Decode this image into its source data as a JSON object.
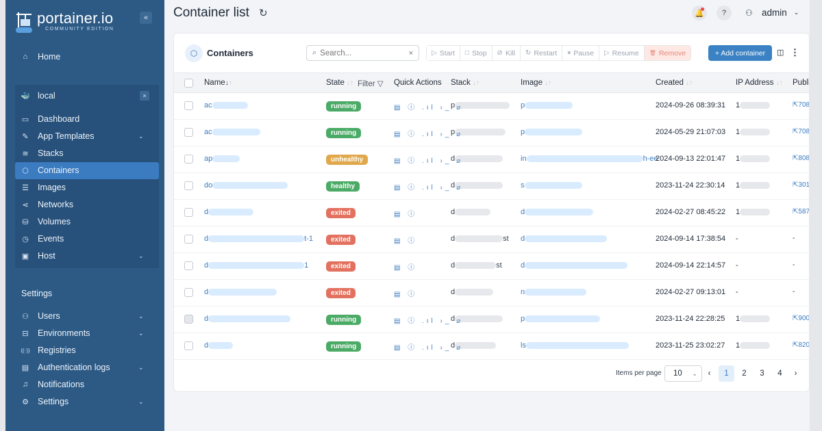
{
  "brand": {
    "title": "portainer.io",
    "subtitle": "COMMUNITY EDITION",
    "collapse_label": "«"
  },
  "sidebar": {
    "home": "Home",
    "environment": {
      "name": "local",
      "close": "×"
    },
    "env_items": [
      {
        "label": "Dashboard",
        "icon": "dashboard-icon",
        "glyph": "▭"
      },
      {
        "label": "App Templates",
        "icon": "edit-icon",
        "glyph": "✎",
        "expandable": true
      },
      {
        "label": "Stacks",
        "icon": "layers-icon",
        "glyph": "≋"
      },
      {
        "label": "Containers",
        "icon": "cube-icon",
        "glyph": "⬡",
        "active": true
      },
      {
        "label": "Images",
        "icon": "list-icon",
        "glyph": "☰"
      },
      {
        "label": "Networks",
        "icon": "share-icon",
        "glyph": "⋖"
      },
      {
        "label": "Volumes",
        "icon": "database-icon",
        "glyph": "⛁"
      },
      {
        "label": "Events",
        "icon": "clock-icon",
        "glyph": "◷"
      },
      {
        "label": "Host",
        "icon": "server-icon",
        "glyph": "▣",
        "expandable": true
      }
    ],
    "settings_heading": "Settings",
    "settings_items": [
      {
        "label": "Users",
        "icon": "users-icon",
        "glyph": "⚇",
        "expandable": true
      },
      {
        "label": "Environments",
        "icon": "drive-icon",
        "glyph": "⊟",
        "expandable": true
      },
      {
        "label": "Registries",
        "icon": "radio-icon",
        "glyph": "((·))"
      },
      {
        "label": "Authentication logs",
        "icon": "file-icon",
        "glyph": "▤",
        "expandable": true
      },
      {
        "label": "Notifications",
        "icon": "bell-icon",
        "glyph": "♫"
      },
      {
        "label": "Settings",
        "icon": "gear-icon",
        "glyph": "⚙",
        "expandable": true
      }
    ]
  },
  "header": {
    "title": "Container list",
    "refresh": "↻",
    "user": "admin"
  },
  "containers_card": {
    "title": "Containers",
    "search_placeholder": "Search...",
    "clear": "×",
    "actions": [
      {
        "label": "Start",
        "glyph": "▷",
        "name": "start-button"
      },
      {
        "label": "Stop",
        "glyph": "□",
        "name": "stop-button"
      },
      {
        "label": "Kill",
        "glyph": "⊘",
        "name": "kill-button"
      },
      {
        "label": "Restart",
        "glyph": "↻",
        "name": "restart-button"
      },
      {
        "label": "Pause",
        "glyph": "⏸",
        "name": "pause-button"
      },
      {
        "label": "Resume",
        "glyph": "▷",
        "name": "resume-button"
      },
      {
        "label": "Remove",
        "glyph": "🗑",
        "name": "remove-button",
        "danger": true
      }
    ],
    "add_label": "+ Add container",
    "columns": {
      "name": "Name",
      "state": "State",
      "filter": "Filter",
      "quick_actions": "Quick Actions",
      "stack": "Stack",
      "image": "Image",
      "created": "Created",
      "ip": "IP Address",
      "published": "Publi"
    },
    "rows": [
      {
        "name": "ac",
        "state": "running",
        "quick": "▤ ⓘ .ıl ›_ ⌀",
        "stack": "p",
        "image": "p",
        "created": "2024-09-26 08:39:31",
        "ip": "1",
        "published": "⇱708"
      },
      {
        "name": "ac",
        "state": "running",
        "quick": "▤ ⓘ .ıl ›_ ⌀",
        "stack": "p",
        "image": "p",
        "created": "2024-05-29 21:07:03",
        "ip": "1",
        "published": "⇱708"
      },
      {
        "name": "ap",
        "state": "unhealthy",
        "quick": "▤ ⓘ .ıl ›_ ⌀",
        "stack": "d",
        "image": "in",
        "image_tail": "h-ee",
        "created": "2024-09-13 22:01:47",
        "ip": "1",
        "published": "⇱808"
      },
      {
        "name": "do",
        "state": "healthy",
        "quick": "▤ ⓘ .ıl ›_ ⌀",
        "stack": "d",
        "image": "s",
        "created": "2023-11-24 22:30:14",
        "ip": "1",
        "published": "⇱301"
      },
      {
        "name": "d",
        "state": "exited",
        "quick": "▤ ⓘ",
        "stack": "d",
        "image": "d",
        "created": "2024-02-27 08:45:22",
        "ip": "1",
        "published": "⇱587"
      },
      {
        "name": "d",
        "name_tail": "t-1",
        "state": "exited",
        "quick": "▤ ⓘ",
        "stack": "d",
        "stack_tail": "st",
        "image": "d",
        "created": "2024-09-14 17:38:54",
        "ip": "-",
        "published": "-"
      },
      {
        "name": "d",
        "name_tail": "1",
        "state": "exited",
        "quick": "▤ ⓘ",
        "stack": "d",
        "stack_tail": "st",
        "image": "d",
        "created": "2024-09-14 22:14:57",
        "ip": "-",
        "published": "-"
      },
      {
        "name": "d",
        "state": "exited",
        "quick": "▤ ⓘ",
        "stack": "d",
        "image": "n",
        "created": "2024-02-27 09:13:01",
        "ip": "-",
        "published": "-"
      },
      {
        "name": "d",
        "state": "running",
        "quick": "▤ ⓘ .ıl ›_ ⌀",
        "stack": "d",
        "image": "p",
        "created": "2023-11-24 22:28:25",
        "ip": "1",
        "published": "⇱900"
      },
      {
        "name": "d",
        "state": "running",
        "quick": "▤ ⓘ .ıl ›_ ⌀",
        "stack": "d",
        "image": "ls",
        "created": "2023-11-25 23:02:27",
        "ip": "1",
        "published": "⇱820"
      }
    ],
    "pagination": {
      "items_per_page_label": "Items per page",
      "items_per_page": "10",
      "prev": "‹",
      "pages": [
        "1",
        "2",
        "3",
        "4"
      ],
      "current": "1",
      "next": "›"
    }
  },
  "colors": {
    "sidebar": "#2d5a85",
    "active_nav": "#3b7bc0",
    "running": "#4bab66",
    "unhealthy": "#e0a84a",
    "exited": "#e2715f",
    "primary": "#3b82c4"
  }
}
